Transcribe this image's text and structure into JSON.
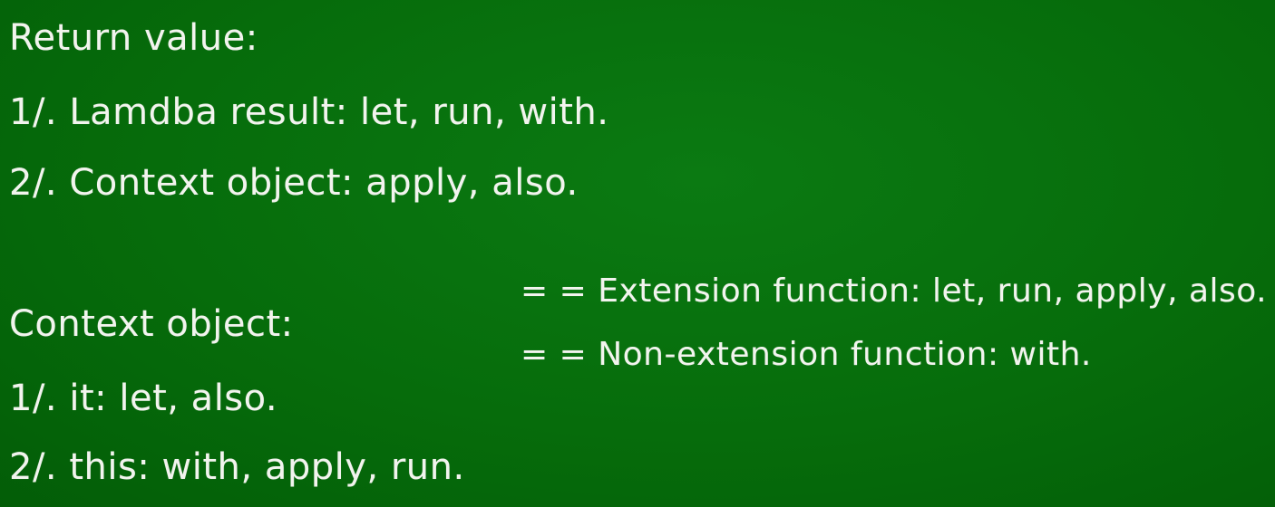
{
  "return_value": {
    "heading": "Return value:",
    "items": [
      "1/.  Lamdba result: let, run, with.",
      "2/. Context object: apply, also."
    ]
  },
  "context_object": {
    "heading": "Context object:",
    "items": [
      "1/.  it: let, also.",
      "2/. this: with, apply, run."
    ]
  },
  "notes": [
    "= = Extension function: let, run, apply, also.",
    "= = Non-extension function: with."
  ],
  "colors": {
    "background": "#066c0b",
    "text": "#f2f4ee"
  }
}
